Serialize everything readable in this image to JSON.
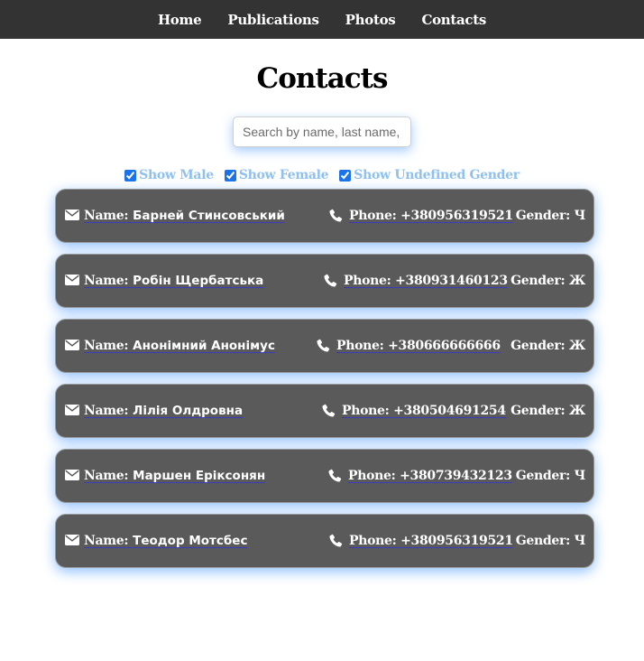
{
  "nav": {
    "items": [
      {
        "label": "Home"
      },
      {
        "label": "Publications"
      },
      {
        "label": "Photos"
      },
      {
        "label": "Contacts"
      }
    ]
  },
  "page": {
    "title": "Contacts"
  },
  "search": {
    "placeholder": "Search by name, last name, or phone",
    "value": ""
  },
  "filters": [
    {
      "label": "Show Male",
      "checked": true
    },
    {
      "label": "Show Female",
      "checked": true
    },
    {
      "label": "Show Undefined Gender",
      "checked": true
    }
  ],
  "labels": {
    "name": "Name:",
    "phone": "Phone:",
    "gender": "Gender:"
  },
  "icons": {
    "mail": "envelope-icon",
    "phone": "phone-icon"
  },
  "colors": {
    "navbar": "#333333",
    "card": "#5a5a5a",
    "filter_label": "#8ec1f0",
    "card_glow": "#82b9ff"
  },
  "contacts": [
    {
      "name": "Барней Стинсовський",
      "phone": "+380956319521",
      "gender": "Ч"
    },
    {
      "name": "Робін Щербатська",
      "phone": "+380931460123",
      "gender": "Ж"
    },
    {
      "name": "Анонімний Анонімус",
      "phone": "+380666666666",
      "gender": "Ж"
    },
    {
      "name": "Лілія Олдровна",
      "phone": "+380504691254",
      "gender": "Ж"
    },
    {
      "name": "Маршен Еріксонян",
      "phone": "+380739432123",
      "gender": "Ч"
    },
    {
      "name": "Теодор Мотсбес",
      "phone": "+380956319521",
      "gender": "Ч"
    }
  ]
}
